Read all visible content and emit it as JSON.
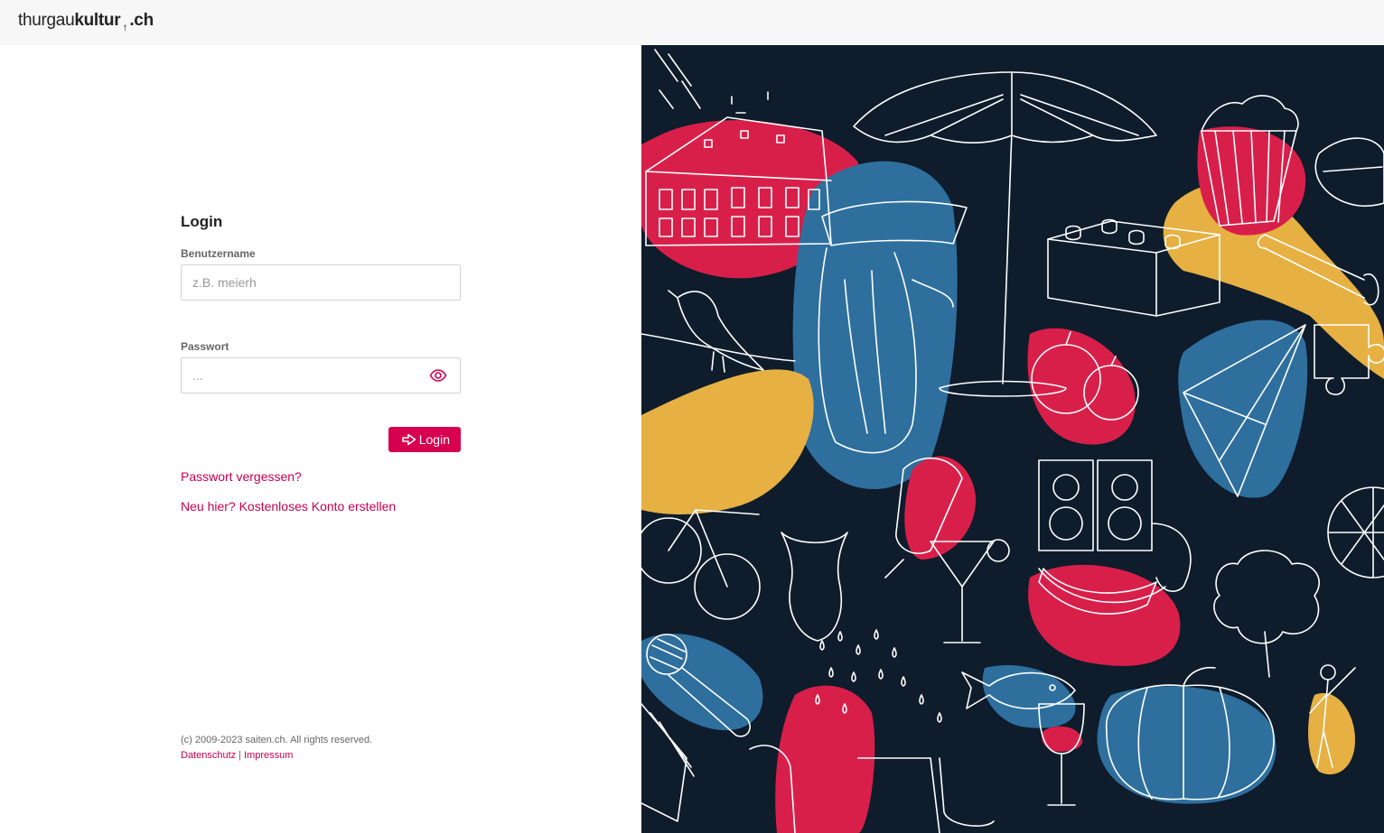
{
  "header": {
    "logo_part1": "thurgau",
    "logo_part2": "kultur",
    "logo_arrow": "↑",
    "logo_part3": ".ch"
  },
  "login_form": {
    "title": "Login",
    "username_label": "Benutzername",
    "username_placeholder": "z.B. meierh",
    "password_label": "Passwort",
    "password_placeholder": "...",
    "login_button": "Login",
    "forgot_password_link": "Passwort vergessen?",
    "register_link": "Neu hier? Kostenloses Konto erstellen"
  },
  "footer": {
    "copyright": "(c) 2009-2023 saiten.ch. All rights reserved.",
    "privacy_link": "Datenschutz",
    "separator": "|",
    "imprint_link": "Impressum"
  },
  "colors": {
    "accent": "#d6004f",
    "artwork_background": "#0e1c2b",
    "artwork_red": "#d81f4a",
    "artwork_blue": "#2e6f9e",
    "artwork_yellow": "#e6b043"
  },
  "icons": {
    "password_toggle": "eye-icon",
    "login_button": "login-arrow-icon",
    "decorative_artwork": "illustration"
  }
}
